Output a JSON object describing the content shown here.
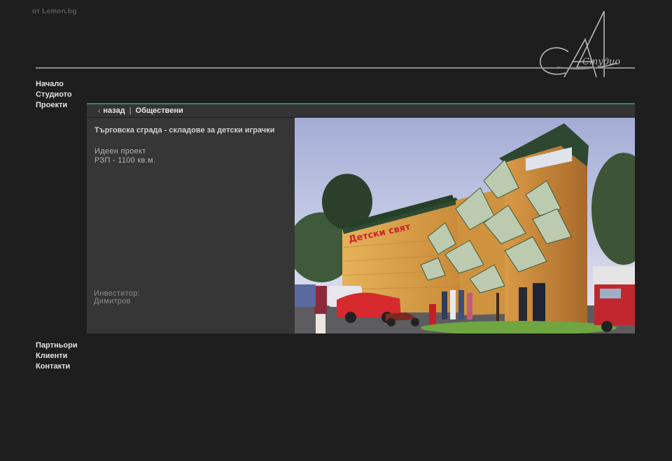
{
  "credit": "от Lemon.bg",
  "logo": {
    "text": "Студио"
  },
  "nav_top": [
    "Начало",
    "Студиото",
    "Проекти"
  ],
  "nav_bottom": [
    "Партньори",
    "Клиенти",
    "Контакти"
  ],
  "breadcrumb": {
    "back_icon": "‹",
    "back": "назад",
    "separator": "|",
    "category": "Обществени"
  },
  "project": {
    "title": "Търговска сграда - складове за детски играчки",
    "type": "Идеен проект",
    "area": "РЗП - 1100 кв.м.",
    "investor_label": "Инвеститор:",
    "investor": "Димитров"
  },
  "photo": {
    "sign_text": "Детски свят"
  },
  "colors": {
    "background": "#1e1e1e",
    "accent_line": "#2e8d5b",
    "panel": "#363636"
  }
}
